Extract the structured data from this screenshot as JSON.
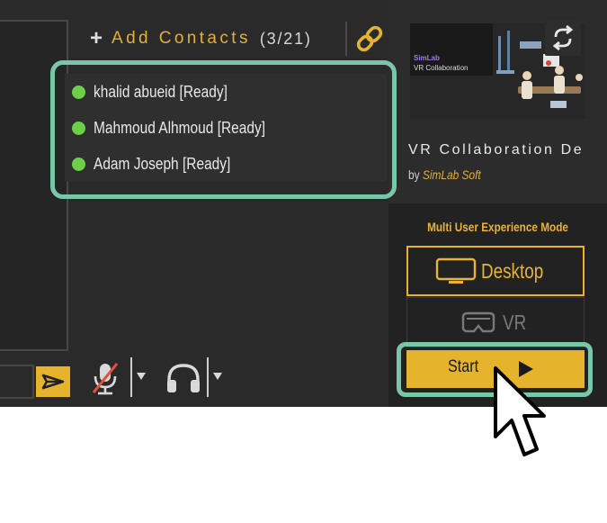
{
  "contacts_panel": {
    "add_contacts_plus": "+",
    "add_contacts_label": "Add Contacts",
    "contact_count": "(3/21)",
    "contacts": [
      {
        "name": "khalid abueid",
        "status": "[Ready]",
        "status_color": "#6bd047"
      },
      {
        "name": "Mahmoud Alhmoud",
        "status": "[Ready]",
        "status_color": "#6bd047"
      },
      {
        "name": "Adam Joseph",
        "status": "[Ready]",
        "status_color": "#6bd047"
      }
    ]
  },
  "project": {
    "thumbnail_brand": "SimLab",
    "thumbnail_subtitle": "VR Collaboration",
    "title": "VR Collaboration De",
    "by_label": "by",
    "author": "SimLab Soft"
  },
  "mode_selector": {
    "title": "Multi User Experience Mode",
    "options": [
      {
        "label": "Desktop",
        "selected": true
      },
      {
        "label": "VR",
        "selected": false
      }
    ]
  },
  "actions": {
    "start_label": "Start"
  },
  "controls": {
    "microphone_muted": true,
    "icons": [
      "send-icon",
      "microphone-muted-icon",
      "headphones-icon",
      "link-icon",
      "refresh-icon",
      "desktop-icon",
      "vr-headset-icon",
      "play-icon"
    ]
  },
  "colors": {
    "accent": "#e5b42c",
    "highlight": "#79c7a8",
    "ready": "#6bd047",
    "background": "#2a2a2a"
  }
}
